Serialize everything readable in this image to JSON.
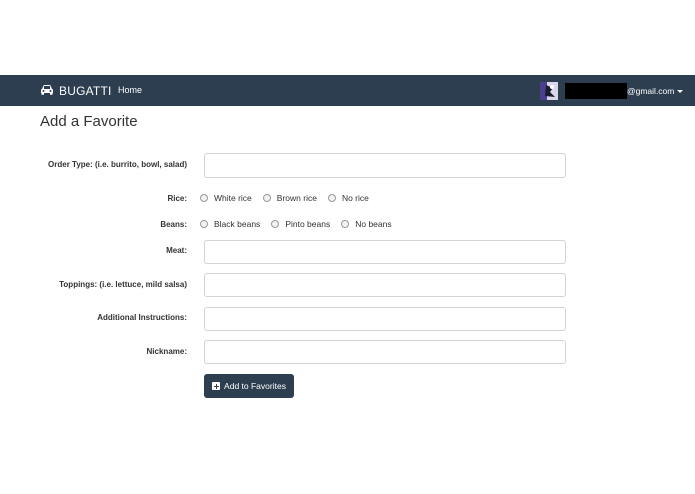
{
  "navbar": {
    "brand": "BUGATTI",
    "brand_icon": "car-icon",
    "home": "Home",
    "email_suffix": "@gmail.com"
  },
  "page_title": "Add a Favorite",
  "form": {
    "order_type_label": "Order Type: (i.e. burrito, bowl, salad)",
    "rice_label": "Rice:",
    "rice_options": [
      "White rice",
      "Brown rice",
      "No rice"
    ],
    "beans_label": "Beans:",
    "beans_options": [
      "Black beans",
      "Pinto beans",
      "No beans"
    ],
    "meat_label": "Meat:",
    "toppings_label": "Toppings: (i.e. lettuce, mild salsa)",
    "instructions_label": "Additional Instructions:",
    "nickname_label": "Nickname:",
    "submit_label": "Add to Favorites",
    "submit_icon": "plus-square-icon"
  },
  "colors": {
    "navbar_bg": "#2c3e50",
    "button_bg": "#2c3e50"
  }
}
